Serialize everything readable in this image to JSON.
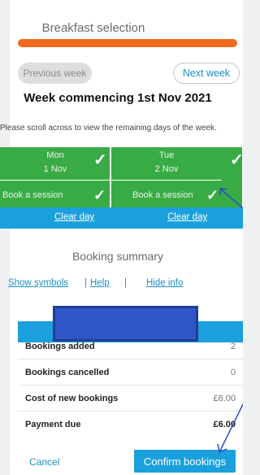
{
  "page": {
    "title": "Breakfast selection"
  },
  "nav": {
    "previous_label": "Previous week",
    "next_label": "Next week"
  },
  "week": {
    "heading": "Week commencing 1st Nov 2021"
  },
  "instructions": "Please scroll across to view the remaining days of the week.",
  "days": [
    {
      "name": "Mon",
      "date": "1 Nov",
      "session_label": "Book a session",
      "clear_label": "Clear day"
    },
    {
      "name": "Tue",
      "date": "2 Nov",
      "session_label": "Book a session",
      "clear_label": "Clear day"
    }
  ],
  "summary": {
    "heading": "Booking summary",
    "links": {
      "symbols": "Show symbols",
      "help": "Help",
      "hide": "Hide info",
      "separator": "|"
    },
    "rows": [
      {
        "label": "Bookings added",
        "value": "2"
      },
      {
        "label": "Bookings cancelled",
        "value": "0"
      },
      {
        "label": "Cost of new bookings",
        "value": "£6.00"
      },
      {
        "label": "Payment due",
        "value": "£6.00"
      }
    ]
  },
  "actions": {
    "cancel_label": "Cancel",
    "confirm_label": "Confirm bookings"
  },
  "colors": {
    "accent_orange": "#f26a1b",
    "booked_green": "#38ab45",
    "link_blue": "#1a8fc9",
    "bar_blue": "#1aa0dc",
    "annotation_box": "#2f55c6"
  },
  "icons": [
    "check-icon",
    "annotation-arrow"
  ]
}
